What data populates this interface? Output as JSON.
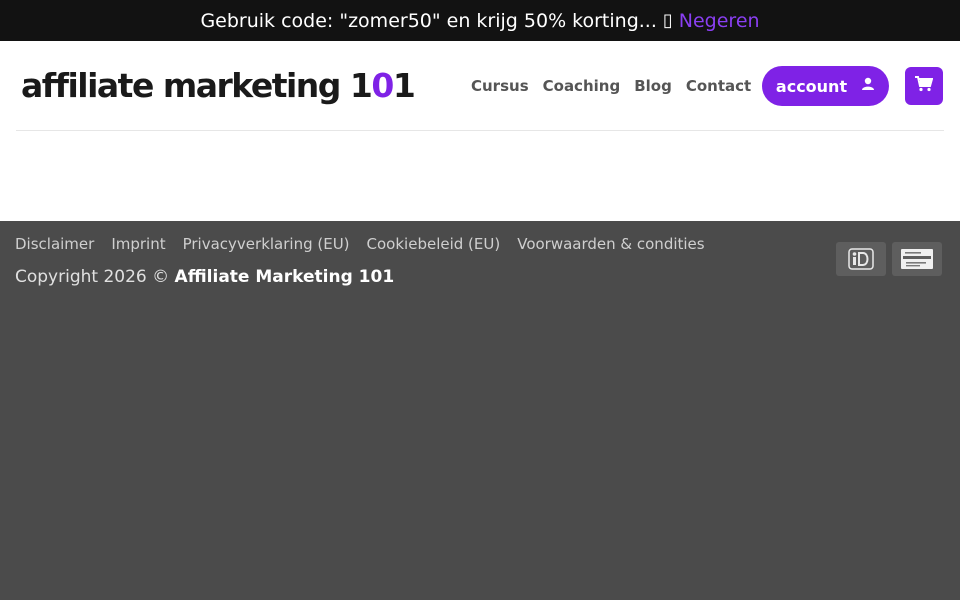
{
  "promo": {
    "text": "Gebruik code: \"zomer50\" en krijg 50% korting...",
    "glyph": "▯",
    "dismiss_label": "Negeren"
  },
  "header": {
    "logo_text": "affiliate marketing ",
    "logo_num_a": "1",
    "logo_num_o": "0",
    "logo_num_b": "1",
    "nav": [
      "Cursus",
      "Coaching",
      "Blog",
      "Contact"
    ],
    "account_label": "account",
    "account_icon": "user-icon",
    "cart_icon": "cart-icon"
  },
  "footer": {
    "links": [
      "Disclaimer",
      "Imprint",
      "Privacyverklaring (EU)",
      "Cookiebeleid (EU)",
      "Voorwaarden & condities"
    ],
    "copyright_prefix": "Copyright 2026 © ",
    "copyright_brand": "Affiliate Marketing 101",
    "payment_icons": [
      "ideal-icon",
      "bancontact-icon"
    ]
  },
  "colors": {
    "accent": "#7f22e6",
    "promo_bg": "#121212",
    "footer_bg": "#4b4b4b"
  }
}
